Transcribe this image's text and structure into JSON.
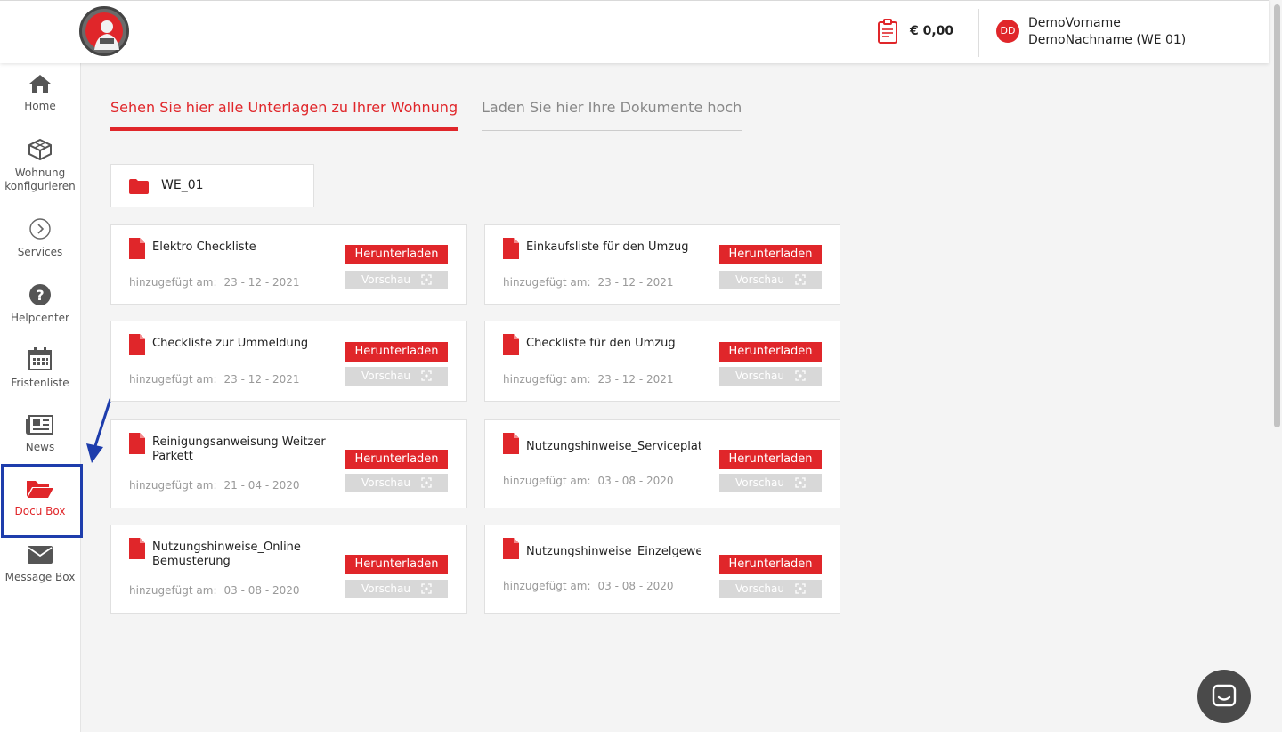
{
  "header": {
    "cart_total": "€ 0,00",
    "avatar_initials": "DD",
    "user_name_line1": "DemoVorname",
    "user_name_line2": "DemoNachname (WE 01)"
  },
  "sidebar": {
    "items": [
      {
        "label": "Home",
        "icon": "home-icon"
      },
      {
        "label": "Wohnung konfigurieren",
        "icon": "cube-icon"
      },
      {
        "label": "Services",
        "icon": "chevron-circle-icon"
      },
      {
        "label": "Helpcenter",
        "icon": "question-icon"
      },
      {
        "label": "Fristenliste",
        "icon": "calendar-icon"
      },
      {
        "label": "News",
        "icon": "newspaper-icon"
      },
      {
        "label": "Docu Box",
        "icon": "folder-open-icon",
        "active": true
      },
      {
        "label": "Message Box",
        "icon": "envelope-icon"
      }
    ]
  },
  "tabs": {
    "active": "Sehen Sie hier alle Unterlagen zu Ihrer Wohnung",
    "inactive": "Laden Sie hier Ihre Dokumente hoch"
  },
  "folder": {
    "name": "WE_01"
  },
  "documents": [
    {
      "title": "Elektro Checkliste",
      "added_label": "hinzugefügt am:",
      "date": "23 - 12 - 2021"
    },
    {
      "title": "Einkaufsliste für den Umzug",
      "added_label": "hinzugefügt am:",
      "date": "23 - 12 - 2021"
    },
    {
      "title": "Checkliste zur Ummeldung",
      "added_label": "hinzugefügt am:",
      "date": "23 - 12 - 2021"
    },
    {
      "title": "Checkliste für den Umzug",
      "added_label": "hinzugefügt am:",
      "date": "23 - 12 - 2021"
    },
    {
      "title": "Reinigungsanweisung Weitzer Parkett",
      "added_label": "hinzugefügt am:",
      "date": "21 - 04 - 2020"
    },
    {
      "title": "Nutzungshinweise_Serviceplattf",
      "added_label": "hinzugefügt am:",
      "date": "03 - 08 - 2020"
    },
    {
      "title": "Nutzungshinweise_Online Bemusterung",
      "added_label": "hinzugefügt am:",
      "date": "03 - 08 - 2020"
    },
    {
      "title": "Nutzungshinweise_Einzelgewerl",
      "added_label": "hinzugefügt am:",
      "date": "03 - 08 - 2020"
    }
  ],
  "buttons": {
    "download": "Herunterladen",
    "preview": "Vorschau"
  },
  "colors": {
    "accent": "#e0262a",
    "highlight_box": "#1e3dac"
  }
}
